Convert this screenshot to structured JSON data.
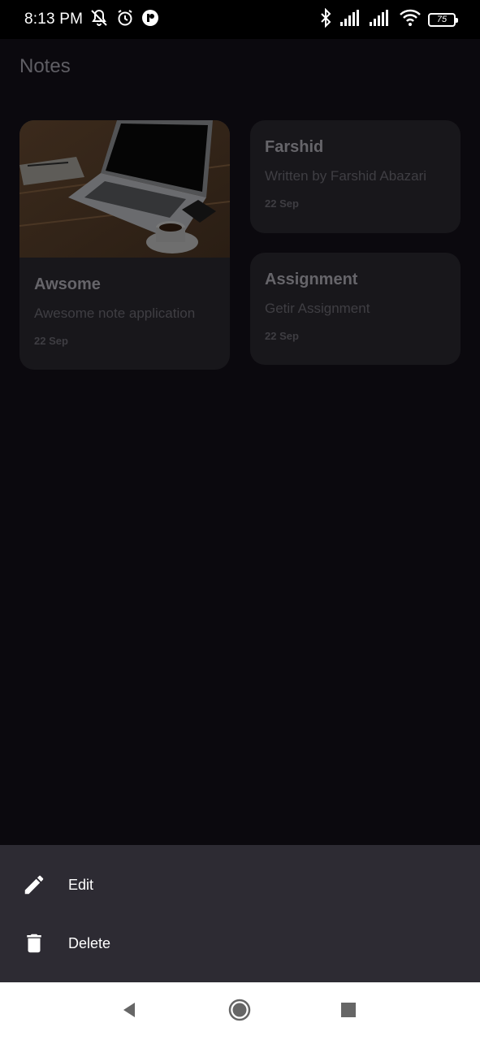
{
  "status_bar": {
    "time": "8:13 PM",
    "battery": "75",
    "icons_left": [
      "mute-icon",
      "alarm-icon",
      "app-notification-icon"
    ],
    "icons_right": [
      "bluetooth-icon",
      "signal-icon",
      "signal-icon",
      "wifi-icon",
      "battery-icon"
    ]
  },
  "app": {
    "title": "Notes",
    "notes": [
      {
        "title": "Awsome",
        "subtitle": "Awesome note application",
        "date": "22 Sep",
        "has_image": true
      },
      {
        "title": "Farshid",
        "subtitle": "Written by Farshid Abazari",
        "date": "22 Sep",
        "has_image": false
      },
      {
        "title": "Assignment",
        "subtitle": "Getir Assignment",
        "date": "22 Sep",
        "has_image": false
      }
    ]
  },
  "sheet": {
    "items": [
      {
        "label": "Edit",
        "icon": "pencil-icon"
      },
      {
        "label": "Delete",
        "icon": "trash-icon"
      }
    ]
  },
  "nav": {
    "buttons": [
      "back-icon",
      "home-icon",
      "recents-icon"
    ]
  },
  "colors": {
    "background": "#0b090e",
    "card": "#18171b",
    "sheet": "#2d2b33",
    "nav": "#ffffff"
  }
}
